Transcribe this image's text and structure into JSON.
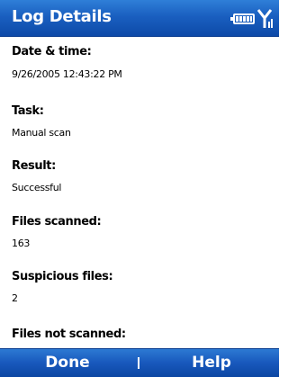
{
  "header": {
    "title": "Log Details",
    "icons": [
      "battery-icon",
      "signal-icon"
    ]
  },
  "fields": [
    {
      "label": "Date & time:",
      "value": "9/26/2005 12:43:22 PM"
    },
    {
      "label": "Task:",
      "value": "Manual scan"
    },
    {
      "label": "Result:",
      "value": "Successful"
    },
    {
      "label": "Files scanned:",
      "value": "163"
    },
    {
      "label": "Suspicious files:",
      "value": "2"
    },
    {
      "label": "Files not scanned:",
      "value": ""
    }
  ],
  "softkeys": {
    "left": "Done",
    "right": "Help"
  },
  "colors": {
    "bar": "#1a5fc0",
    "text": "#000000",
    "background": "#ffffff"
  }
}
